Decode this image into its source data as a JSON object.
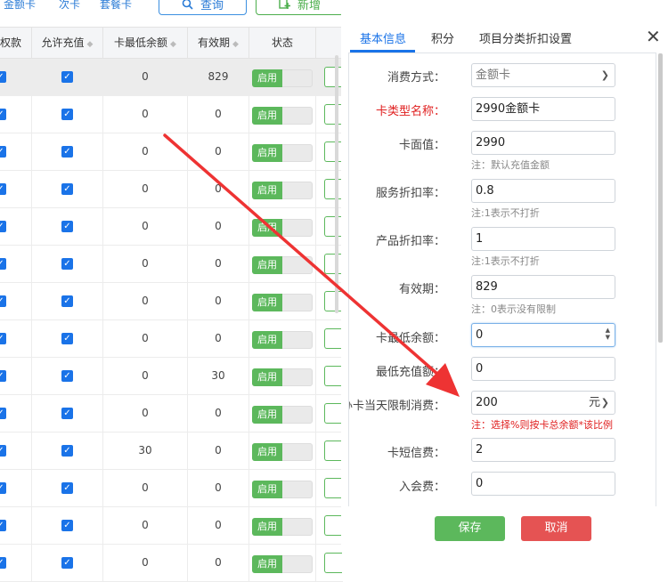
{
  "toolbar": {
    "tabs": [
      "金额卡",
      "次卡",
      "套餐卡"
    ],
    "search_label": "查询",
    "add_label": "新增"
  },
  "table": {
    "headers": [
      "权款",
      "允许充值",
      "卡最低余额",
      "有效期",
      "状态"
    ],
    "status_label": "启用",
    "rows": [
      {
        "min": "0",
        "valid": "829",
        "selected": true
      },
      {
        "min": "0",
        "valid": "0"
      },
      {
        "min": "0",
        "valid": "0"
      },
      {
        "min": "0",
        "valid": "0"
      },
      {
        "min": "0",
        "valid": "0"
      },
      {
        "min": "0",
        "valid": "0"
      },
      {
        "min": "0",
        "valid": "0"
      },
      {
        "min": "0",
        "valid": "0"
      },
      {
        "min": "0",
        "valid": "30"
      },
      {
        "min": "0",
        "valid": "0"
      },
      {
        "min": "30",
        "valid": "0"
      },
      {
        "min": "0",
        "valid": "0"
      },
      {
        "min": "0",
        "valid": "0"
      },
      {
        "min": "0",
        "valid": "0"
      }
    ]
  },
  "dialog": {
    "tabs": [
      "基本信息",
      "积分",
      "项目分类折扣设置"
    ],
    "close_glyph": "✕",
    "fields": {
      "consume_mode": {
        "label": "消费方式：",
        "value": "金额卡"
      },
      "card_type_name": {
        "label": "卡类型名称：",
        "value": "2990金额卡"
      },
      "face_value": {
        "label": "卡面值：",
        "value": "2990",
        "note": "注：默认充值金额"
      },
      "service_discount": {
        "label": "服务折扣率：",
        "value": "0.8",
        "note": "注:1表示不打折"
      },
      "product_discount": {
        "label": "产品折扣率：",
        "value": "1",
        "note": "注:1表示不打折"
      },
      "valid_period": {
        "label": "有效期：",
        "value": "829",
        "note": "注：0表示没有限制"
      },
      "min_balance": {
        "label": "卡最低余额：",
        "value": "0"
      },
      "min_recharge": {
        "label": "最低充值额：",
        "value": "0"
      },
      "day_limit": {
        "label": "办卡当天限制消费：",
        "value": "200",
        "unit": "元",
        "note": "注：选择%则按卡总余额*该比例"
      },
      "sms_fee": {
        "label": "卡短信费：",
        "value": "2"
      },
      "join_fee": {
        "label": "入会费：",
        "value": "0"
      }
    },
    "save_label": "保存",
    "cancel_label": "取消"
  },
  "colors": {
    "primary": "#1a73e8",
    "success": "#5cb85c",
    "danger": "#e55353",
    "annotation": "#ee3333"
  }
}
